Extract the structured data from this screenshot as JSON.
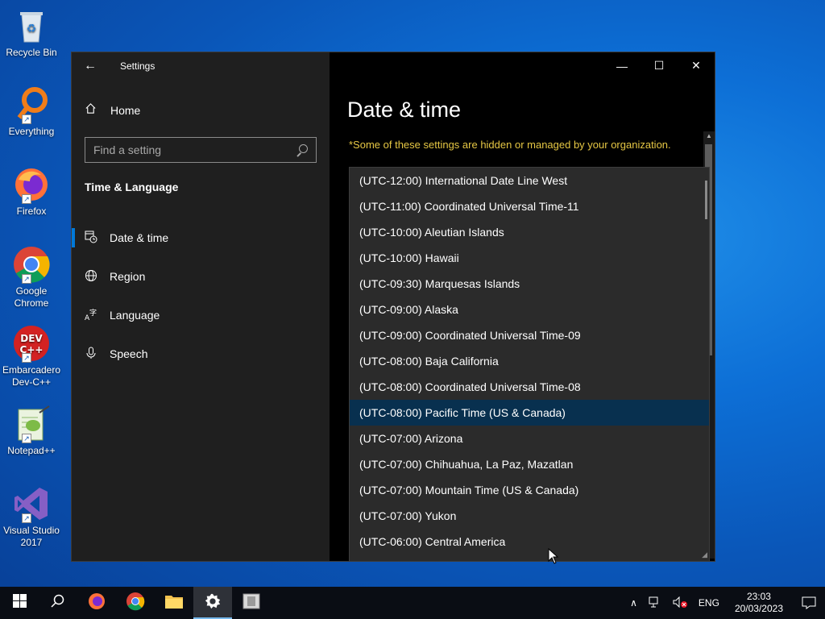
{
  "desktop": {
    "icons": [
      {
        "label": "Recycle Bin"
      },
      {
        "label": "Everything"
      },
      {
        "label": "Firefox"
      },
      {
        "label": "Google Chrome"
      },
      {
        "label": "Embarcadero Dev-C++"
      },
      {
        "label": "Notepad++"
      },
      {
        "label": "Visual Studio 2017"
      }
    ]
  },
  "window": {
    "app_title": "Settings",
    "sidebar": {
      "home_label": "Home",
      "search_placeholder": "Find a setting",
      "section_title": "Time & Language",
      "items": [
        {
          "label": "Date & time",
          "icon": "clock-calendar-icon",
          "active": true
        },
        {
          "label": "Region",
          "icon": "globe-icon",
          "active": false
        },
        {
          "label": "Language",
          "icon": "language-icon",
          "active": false
        },
        {
          "label": "Speech",
          "icon": "microphone-icon",
          "active": false
        }
      ]
    },
    "main": {
      "page_title": "Date & time",
      "notice": "*Some of these settings are hidden or managed by your organization.",
      "timezone_dropdown": {
        "selected": "(UTC-08:00) Pacific Time (US & Canada)",
        "options": [
          "(UTC-12:00) International Date Line West",
          "(UTC-11:00) Coordinated Universal Time-11",
          "(UTC-10:00) Aleutian Islands",
          "(UTC-10:00) Hawaii",
          "(UTC-09:30) Marquesas Islands",
          "(UTC-09:00) Alaska",
          "(UTC-09:00) Coordinated Universal Time-09",
          "(UTC-08:00) Baja California",
          "(UTC-08:00) Coordinated Universal Time-08",
          "(UTC-08:00) Pacific Time (US & Canada)",
          "(UTC-07:00) Arizona",
          "(UTC-07:00) Chihuahua, La Paz, Mazatlan",
          "(UTC-07:00) Mountain Time (US & Canada)",
          "(UTC-07:00) Yukon",
          "(UTC-06:00) Central America"
        ]
      }
    }
  },
  "taskbar": {
    "language": "ENG",
    "time": "23:03",
    "date": "20/03/2023"
  },
  "colors": {
    "accent": "#0078d7",
    "notice": "#e6c744",
    "selected_row": "#08304f"
  }
}
